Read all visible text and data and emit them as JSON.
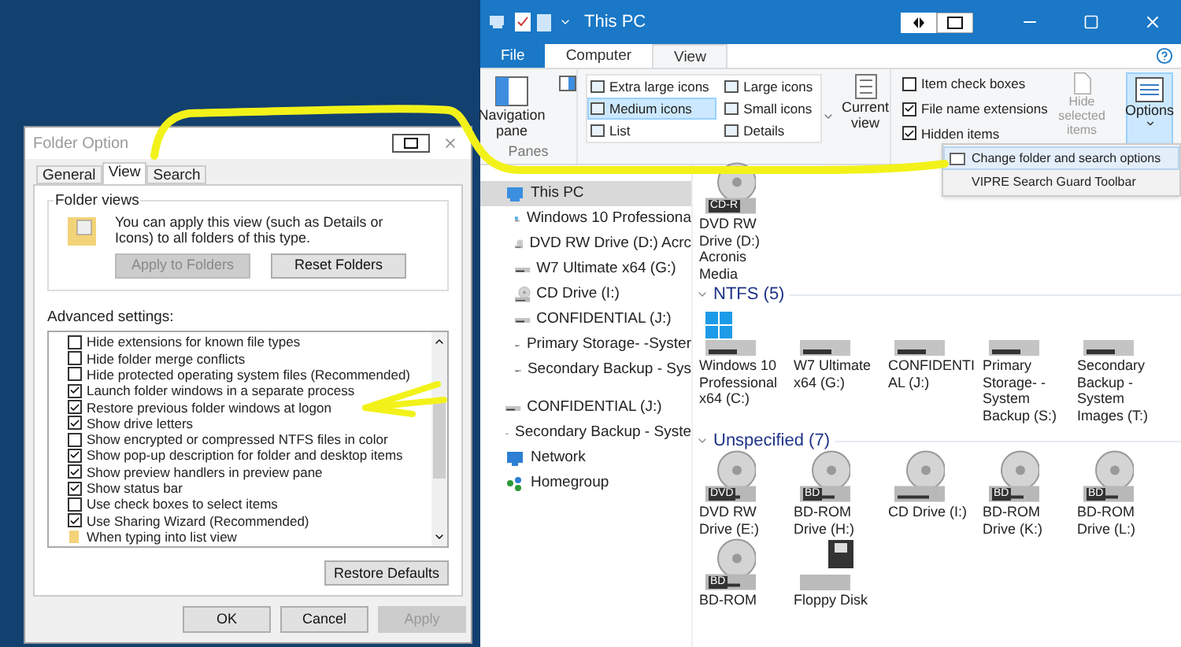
{
  "dialog": {
    "title": "Folder Option",
    "tabs": [
      {
        "label": "General",
        "selected": false
      },
      {
        "label": "View",
        "selected": true
      },
      {
        "label": "Search",
        "selected": false
      }
    ],
    "folder_views": {
      "legend": "Folder views",
      "text": "You can apply this view (such as Details or Icons) to all folders of this type.",
      "buttons": [
        {
          "label": "Apply to Folders",
          "disabled": true
        },
        {
          "label": "Reset Folders",
          "disabled": false
        }
      ]
    },
    "advanced_label": "Advanced settings:",
    "settings": [
      {
        "kind": "checkbox",
        "label": "Hide extensions for known file types",
        "checked": false
      },
      {
        "kind": "checkbox",
        "label": "Hide folder merge conflicts",
        "checked": false
      },
      {
        "kind": "checkbox",
        "label": "Hide protected operating system files (Recommended)",
        "checked": false
      },
      {
        "kind": "checkbox",
        "label": "Launch folder windows in a separate process",
        "checked": true
      },
      {
        "kind": "checkbox",
        "label": "Restore previous folder windows at logon",
        "checked": true
      },
      {
        "kind": "checkbox",
        "label": "Show drive letters",
        "checked": true
      },
      {
        "kind": "checkbox",
        "label": "Show encrypted or compressed NTFS files in color",
        "checked": false
      },
      {
        "kind": "checkbox",
        "label": "Show pop-up description for folder and desktop items",
        "checked": true
      },
      {
        "kind": "checkbox",
        "label": "Show preview handlers in preview pane",
        "checked": true
      },
      {
        "kind": "checkbox",
        "label": "Show status bar",
        "checked": true
      },
      {
        "kind": "checkbox",
        "label": "Use check boxes to select items",
        "checked": false
      },
      {
        "kind": "checkbox",
        "label": "Use Sharing Wizard (Recommended)",
        "checked": true
      },
      {
        "kind": "folder",
        "label": "When typing into list view"
      }
    ],
    "restore_button": "Restore Defaults",
    "buttons": [
      {
        "label": "OK",
        "disabled": false
      },
      {
        "label": "Cancel",
        "disabled": false
      },
      {
        "label": "Apply",
        "disabled": true
      }
    ]
  },
  "explorer": {
    "title": "This PC",
    "ribbon_tabs": [
      {
        "kind": "file",
        "label": "File",
        "selected": false
      },
      {
        "kind": "tab",
        "label": "Computer",
        "selected": false
      },
      {
        "kind": "tab",
        "label": "View",
        "selected": true
      }
    ],
    "navigation_pane": "Navigation pane",
    "panes_label": "Panes",
    "layouts": [
      {
        "label": "Extra large icons",
        "selected": false
      },
      {
        "label": "Medium icons",
        "selected": true
      },
      {
        "label": "List",
        "selected": false
      },
      {
        "label": "Large icons",
        "selected": false
      },
      {
        "label": "Small icons",
        "selected": false
      },
      {
        "label": "Details",
        "selected": false
      }
    ],
    "current_view": "Current view",
    "show_hide": [
      {
        "label": "Item check boxes",
        "checked": false
      },
      {
        "label": "File name extensions",
        "checked": true
      },
      {
        "label": "Hidden items",
        "checked": true
      }
    ],
    "hide_selected": "Hide selected items",
    "options": "Options",
    "menu": [
      {
        "label": "Change folder and search options",
        "hovered": true
      },
      {
        "label": "VIPRE Search Guard Toolbar",
        "hovered": false
      }
    ],
    "nav_items": [
      {
        "kind": "pc",
        "label": "This PC",
        "selected": true,
        "children": [
          {
            "kind": "windows",
            "label": "Windows 10 Professiona",
            "selected": false
          },
          {
            "kind": "dvd",
            "label": "DVD RW Drive (D:) Acrc",
            "selected": false
          },
          {
            "kind": "drive",
            "label": "W7 Ultimate x64 (G:)",
            "selected": false
          },
          {
            "kind": "cd",
            "label": "CD Drive (I:)",
            "selected": false
          },
          {
            "kind": "drive",
            "label": "CONFIDENTIAL (J:)",
            "selected": false
          },
          {
            "kind": "drive",
            "label": "Primary Storage- -Syster",
            "selected": false
          },
          {
            "kind": "drive",
            "label": "Secondary Backup - Sys",
            "selected": false
          }
        ]
      },
      {
        "kind": "drive",
        "label": "CONFIDENTIAL (J:)",
        "selected": false
      },
      {
        "kind": "drive",
        "label": "Secondary Backup - Syste",
        "selected": false
      },
      {
        "kind": "network",
        "label": "Network",
        "selected": false
      },
      {
        "kind": "homegroup",
        "label": "Homegroup",
        "selected": false
      }
    ],
    "groups": [
      {
        "items": [
          {
            "kind": "disc",
            "badge": "CD-R",
            "label": "DVD RW Drive (D:) Acronis Media"
          }
        ]
      },
      {
        "title": "NTFS (5)",
        "items": [
          {
            "kind": "windows",
            "label": "Windows 10 Professional x64 (C:)"
          },
          {
            "kind": "drive",
            "label": "W7 Ultimate x64 (G:)"
          },
          {
            "kind": "drive",
            "label": "CONFIDENTIAL (J:)"
          },
          {
            "kind": "drive",
            "label": "Primary Storage- -System Backup (S:)"
          },
          {
            "kind": "drive",
            "label": "Secondary Backup - System Images (T:)"
          }
        ]
      },
      {
        "title": "Unspecified (7)",
        "items": [
          {
            "kind": "disc",
            "badge": "DVD",
            "label": "DVD RW Drive (E:)"
          },
          {
            "kind": "disc",
            "badge": "BD",
            "label": "BD-ROM Drive (H:)"
          },
          {
            "kind": "cd",
            "label": "CD Drive (I:)"
          },
          {
            "kind": "disc",
            "badge": "BD",
            "label": "BD-ROM Drive (K:)"
          },
          {
            "kind": "disc",
            "badge": "BD",
            "label": "BD-ROM Drive (L:)"
          },
          {
            "kind": "disc",
            "badge": "BD",
            "label": "BD-ROM"
          },
          {
            "kind": "floppy",
            "label": "Floppy Disk"
          }
        ]
      }
    ]
  }
}
